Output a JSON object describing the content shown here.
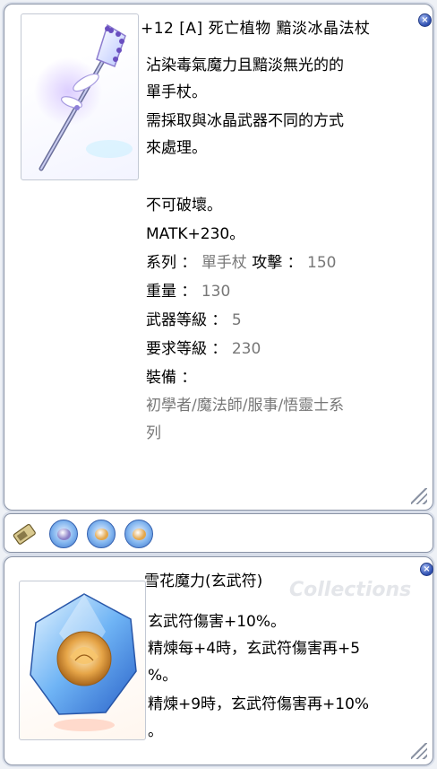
{
  "item": {
    "title": "+12 [A] 死亡植物 黯淡冰晶法杖",
    "description": [
      "沾染毒氣魔力且黯淡無光的的",
      "單手杖。",
      "需採取與冰晶武器不同的方式",
      "來處理。"
    ],
    "indestructible": "不可破壞。",
    "matk": "MATK+230。",
    "stats": {
      "type_label": "系列 ：",
      "type_value": "單手杖",
      "attack_label": "攻擊 ：",
      "attack_value": "150",
      "weight_label": "重量 ：",
      "weight_value": "130",
      "weapon_level_label": "武器等級 ：",
      "weapon_level_value": "5",
      "required_level_label": "要求等級 ：",
      "required_level_value": "230",
      "equip_label": "裝備 ：",
      "equip_value_line1": "初學者/魔法師/服事/悟靈士系",
      "equip_value_line2": "列"
    }
  },
  "card": {
    "title": "雪花魔力(玄武符)",
    "watermark": "Collections",
    "lines": [
      "玄武符傷害+10%。",
      "精煉每+4時，玄武符傷害再+5",
      "%。",
      "精煉+9時，玄武符傷害再+10%",
      "。"
    ]
  },
  "icons": {
    "close": "×",
    "slot_card_icon": "card-icon",
    "slot_gems": [
      "#8a7fc7",
      "#e3a64a",
      "#e3a64a"
    ]
  },
  "colors": {
    "stat_value": "#777777",
    "close_button": "#2e4fb0"
  }
}
